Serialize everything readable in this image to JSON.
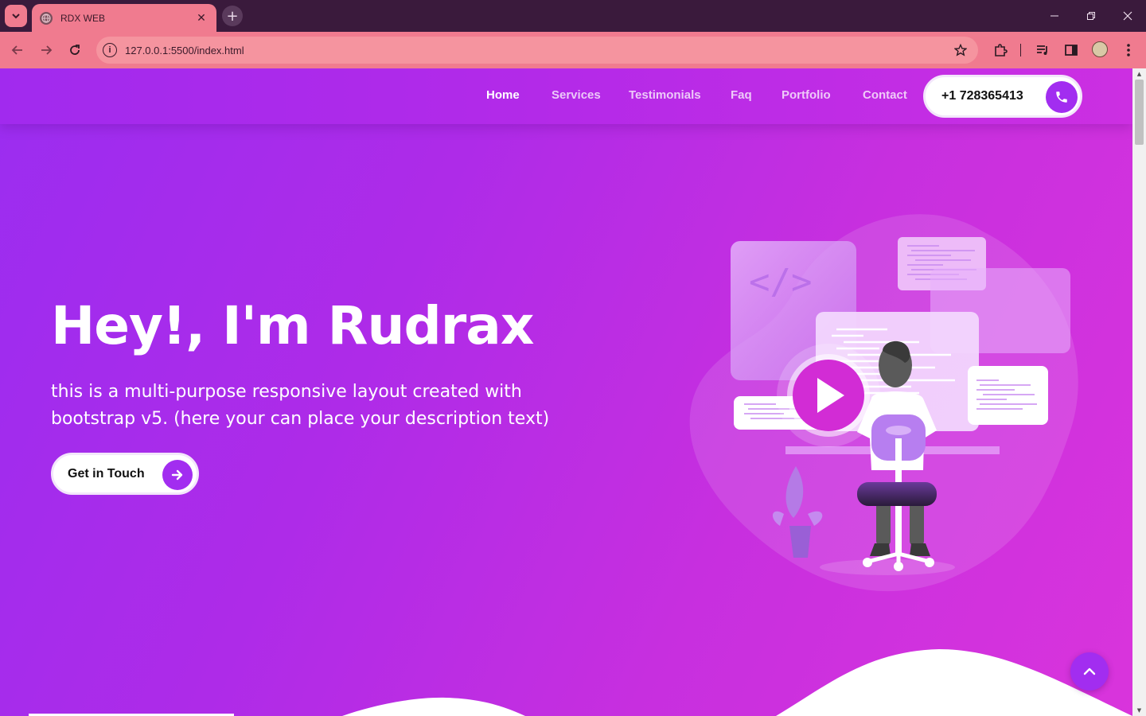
{
  "browser": {
    "tab_title": "RDX WEB",
    "url": "127.0.0.1:5500/index.html"
  },
  "nav": {
    "links": [
      {
        "label": "Home",
        "active": true
      },
      {
        "label": "Services",
        "active": false
      },
      {
        "label": "Testimonials",
        "active": false
      },
      {
        "label": "Faq",
        "active": false
      },
      {
        "label": "Portfolio",
        "active": false
      },
      {
        "label": "Contact",
        "active": false
      }
    ],
    "phone": "+1 728365413"
  },
  "hero": {
    "title": "Hey!, I'm Rudrax",
    "description": "this is a multi-purpose responsive layout created with bootstrap v5. (here your can place your description text)",
    "cta_label": "Get in Touch"
  },
  "illustration": {
    "code_tag": "</>"
  },
  "colors": {
    "accent": "#a22df0",
    "tab_bar": "#f07b8f",
    "gradient_start": "#9b2df0",
    "gradient_end": "#d934dc"
  },
  "icons": {
    "phone": "phone-icon",
    "cta": "arrow-right-icon",
    "back_to_top": "chevron-up-icon",
    "play": "play-icon"
  }
}
